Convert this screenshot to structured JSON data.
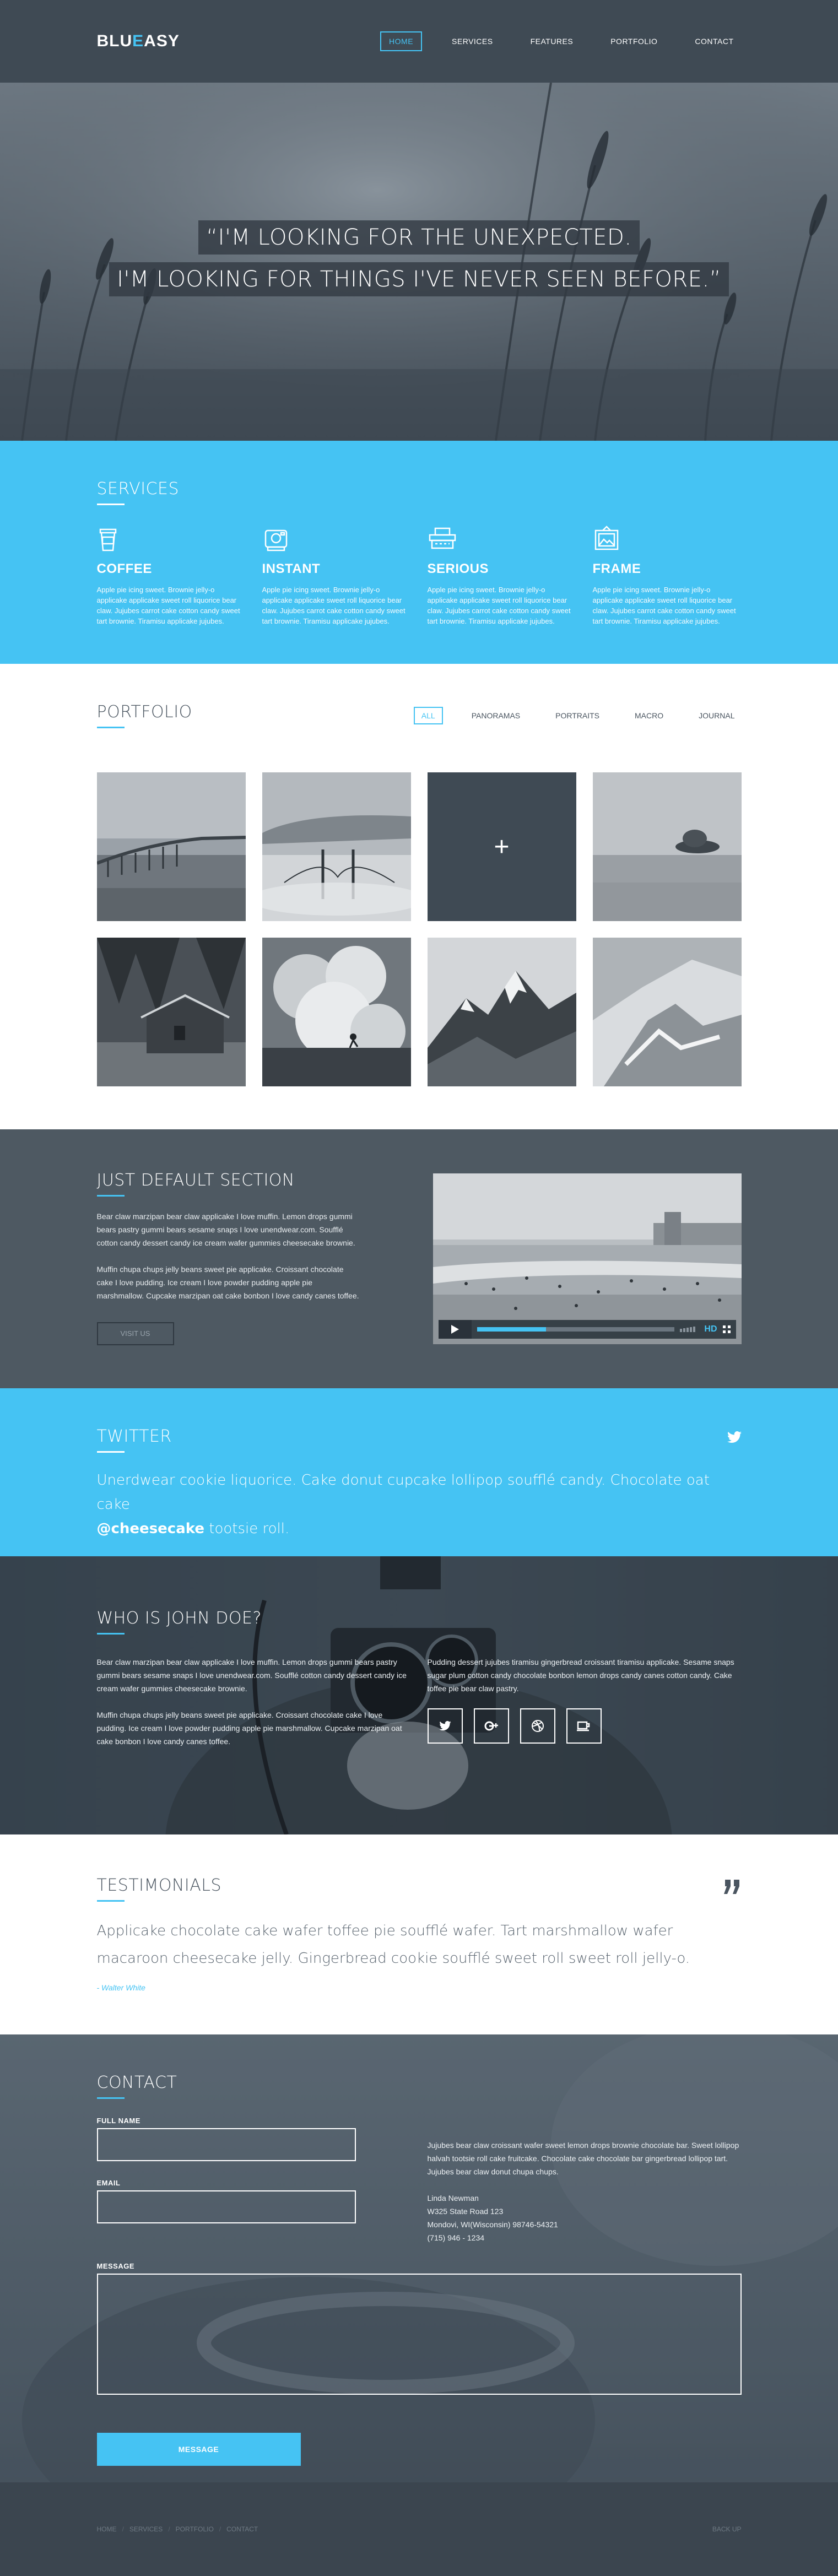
{
  "brand": {
    "part1": "BLU",
    "part2": "E",
    "part3": "ASY",
    "accent": "#45c3f3"
  },
  "nav": [
    "HOME",
    "SERVICES",
    "FEATURES",
    "PORTFOLIO",
    "CONTACT"
  ],
  "hero": {
    "line1": "“I'M LOOKING FOR THE UNEXPECTED.",
    "line2": "I'M LOOKING FOR THINGS I'VE NEVER SEEN BEFORE.”"
  },
  "services": {
    "title": "SERVICES",
    "items": [
      {
        "icon": "coffee-cup-icon",
        "name": "COFFEE",
        "text": "Apple pie icing sweet. Brownie jelly-o applicake applicake sweet roll liquorice bear claw. Jujubes carrot cake cotton candy sweet tart brownie. Tiramisu applicake jujubes."
      },
      {
        "icon": "instant-camera-icon",
        "name": "INSTANT",
        "text": "Apple pie icing sweet. Brownie jelly-o applicake applicake sweet roll liquorice bear claw. Jujubes carrot cake cotton candy sweet tart brownie. Tiramisu applicake jujubes."
      },
      {
        "icon": "typewriter-icon",
        "name": "SERIOUS",
        "text": "Apple pie icing sweet. Brownie jelly-o applicake applicake sweet roll liquorice bear claw. Jujubes carrot cake cotton candy sweet tart brownie. Tiramisu applicake jujubes."
      },
      {
        "icon": "picture-frame-icon",
        "name": "FRAME",
        "text": "Apple pie icing sweet. Brownie jelly-o applicake applicake sweet roll liquorice bear claw. Jujubes carrot cake cotton candy sweet tart brownie. Tiramisu applicake jujubes."
      }
    ]
  },
  "portfolio": {
    "title": "PORTFOLIO",
    "filters": [
      "ALL",
      "PANORAMAS",
      "PORTRAITS",
      "MACRO",
      "JOURNAL"
    ],
    "plus": "+"
  },
  "default_section": {
    "title": "JUST DEFAULT SECTION",
    "p1": "Bear claw marzipan bear claw applicake I love muffin. Lemon drops gummi bears pastry gummi bears sesame snaps I love unendwear.com. Soufflé cotton candy dessert candy ice cream wafer gummies cheesecake brownie.",
    "p2": "Muffin chupa chups jelly beans sweet pie applicake. Croissant chocolate cake I love pudding. Ice cream I love powder pudding apple pie marshmallow. Cupcake marzipan oat cake bonbon I love candy canes toffee.",
    "button": "VISIT US",
    "video": {
      "progress": 0.35,
      "hd": "HD"
    }
  },
  "twitter": {
    "title": "TWITTER",
    "text": "Unerdwear cookie liquorice. Cake donut cupcake lollipop soufflé candy. Chocolate oat cake",
    "handle": "@cheesecake",
    "tail": " tootsie roll."
  },
  "who": {
    "title": "WHO IS JOHN DOE?",
    "p1": "Bear claw marzipan bear claw applicake I love muffin. Lemon drops gummi bears pastry gummi bears sesame snaps I love unendwear.com. Soufflé cotton candy dessert candy ice cream wafer gummies cheesecake brownie.",
    "p2": "Muffin chupa chups jelly beans sweet pie applicake. Croissant chocolate cake I love pudding. Ice cream I love powder pudding apple pie marshmallow. Cupcake marzipan oat cake bonbon I love candy canes toffee.",
    "p3": "Pudding dessert jujubes tiramisu gingerbread croissant tiramisu applicake. Sesame snaps sugar plum cotton candy chocolate bonbon lemon drops candy canes cotton candy. Cake toffee pie bear claw pastry.",
    "socials": [
      "twitter-icon",
      "google-plus-icon",
      "dribbble-icon",
      "coffee-icon"
    ]
  },
  "testimonials": {
    "title": "TESTIMONIALS",
    "text": "Applicake chocolate cake wafer toffee pie soufflé wafer. Tart marshmallow wafer macaroon cheesecake jelly. Gingerbread cookie soufflé sweet roll sweet roll jelly-o.",
    "author": "- Walter White"
  },
  "contact": {
    "title": "CONTACT",
    "name_label": "FULL NAME",
    "email_label": "EMAIL",
    "message_label": "MESSAGE",
    "name_value": "",
    "email_value": "",
    "message_value": "",
    "submit": "MESSAGE",
    "about": "Jujubes bear claw croissant wafer sweet lemon drops brownie chocolate bar. Sweet lollipop halvah tootsie roll cake fruitcake. Chocolate cake chocolate bar gingerbread lollipop tart. Jujubes bear claw donut chupa chups.",
    "addr_name": "Linda Newman",
    "addr_street": "W325 State Road 123",
    "addr_city": "Mondovi, WI(Wisconsin) 98746-54321",
    "addr_phone": "(715) 946 - 1234"
  },
  "footer": {
    "links": [
      "HOME",
      "SERVICES",
      "PORTFOLIO",
      "CONTACT"
    ],
    "sep": "/",
    "right": "BACK UP"
  }
}
